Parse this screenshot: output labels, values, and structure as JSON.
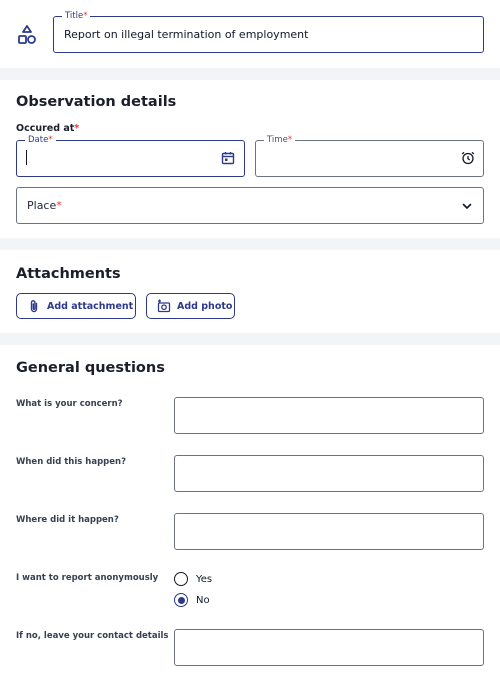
{
  "title_field": {
    "label": "Title",
    "required_mark": "*",
    "value": "Report on illegal termination of employment",
    "icon": "shapes-icon"
  },
  "observation": {
    "heading": "Observation details",
    "occured_at_label": "Occured at",
    "required_mark": "*",
    "date": {
      "label": "Date",
      "required_mark": "*",
      "value": "",
      "icon": "calendar-icon"
    },
    "time": {
      "label": "Time",
      "required_mark": "*",
      "value": "",
      "icon": "alarm-clock-icon"
    },
    "place": {
      "label": "Place",
      "required_mark": "*",
      "icon": "chevron-down-icon"
    }
  },
  "attachments": {
    "heading": "Attachments",
    "add_attachment_label": "Add attachment",
    "add_photo_label": "Add photo"
  },
  "general_questions": {
    "heading": "General questions",
    "q_concern": "What is your concern?",
    "q_when": "When did this happen?",
    "q_where": "Where did it happen?",
    "q_anonymous": "I want to report anonymously",
    "anonymous_options": [
      "Yes",
      "No"
    ],
    "anonymous_selected": "No",
    "q_contact": "If no, leave your contact details"
  },
  "colors": {
    "accent": "#2d3a8c",
    "required": "#e53935",
    "background": "#f2f4f8"
  }
}
